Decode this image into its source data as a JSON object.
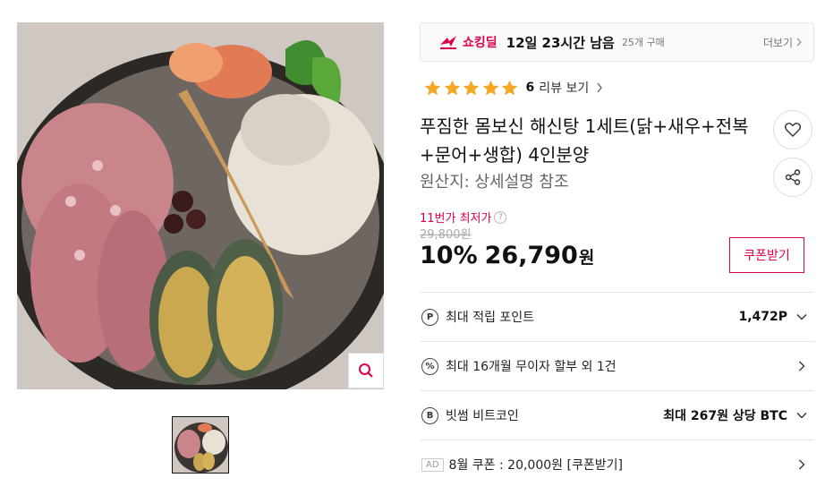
{
  "deal": {
    "label": "쇼킹딜",
    "time_left": "12일 23시간 남음",
    "bought": "25개 구매",
    "more": "더보기"
  },
  "rating": {
    "stars": 5,
    "count": "6",
    "review_link": "리뷰 보기"
  },
  "product": {
    "title": "푸짐한 몸보신 해신탕 1세트(닭+새우+전복+문어+생합) 4인분양",
    "origin": "원산지: 상세설명 참조"
  },
  "price": {
    "lowest_label": "11번가 최저가",
    "original": "29,800원",
    "discount": "10%",
    "sale": "26,790",
    "currency": "원",
    "coupon_button": "쿠폰받기"
  },
  "benefits": [
    {
      "icon": "P",
      "text": "최대 적립 포인트",
      "value": "1,472P",
      "chevron": "down"
    },
    {
      "icon": "%",
      "text": "최대 16개월 무이자 할부 외 1건",
      "value": "",
      "chevron": "right"
    },
    {
      "icon": "B",
      "text": "빗썸 비트코인",
      "value": "최대 267원 상당 BTC",
      "chevron": "down"
    },
    {
      "ad": "AD",
      "text": "8월 쿠폰 : 20,000원 [쿠폰받기]",
      "value": "",
      "chevron": "right"
    }
  ],
  "colors": {
    "accent": "#e0004a",
    "star": "#f5a623"
  }
}
